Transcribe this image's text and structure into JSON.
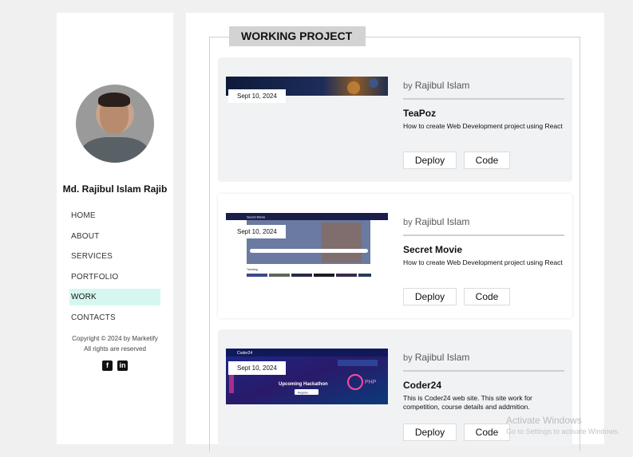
{
  "sidebar": {
    "name": "Md. Rajibul Islam Rajib",
    "nav": [
      {
        "label": "HOME"
      },
      {
        "label": "ABOUT"
      },
      {
        "label": "SERVICES"
      },
      {
        "label": "PORTFOLIO"
      },
      {
        "label": "WORK"
      },
      {
        "label": "CONTACTS"
      }
    ],
    "active_item": "WORK",
    "copyright_line1": "Copyright © 2024 by Marketify",
    "copyright_line2": "All rights are reserved",
    "social_icons": [
      "facebook-icon",
      "linkedin-icon"
    ]
  },
  "main": {
    "heading": "WORKING PROJECT",
    "projects": [
      {
        "date": "Sept 10, 2024",
        "by_prefix": "by",
        "author": "Rajibul Islam",
        "title": "TeaPoz",
        "description": "How to create Web Development project using React",
        "deploy_label": "Deploy",
        "code_label": "Code"
      },
      {
        "date": "Sept 10, 2024",
        "by_prefix": "by",
        "author": "Rajibul Islam",
        "title": "Secret Movie",
        "description": "How to create Web Development project using React",
        "deploy_label": "Deploy",
        "code_label": "Code",
        "thumb_nav_title": "Secret Movie",
        "thumb_section": "Trending"
      },
      {
        "date": "Sept 10, 2024",
        "by_prefix": "by",
        "author": "Rajibul Islam",
        "title": "Coder24",
        "description": "This is Coder24 web site. This site work for competition, course details and addmition.",
        "deploy_label": "Deploy",
        "code_label": "Code",
        "thumb_brand": "Coder24",
        "thumb_headline": "Upcoming Hackathon",
        "thumb_button": "Register",
        "thumb_badge": "PHP"
      }
    ]
  },
  "watermark": {
    "line1": "Activate Windows",
    "line2": "Go to Settings to activate Windows."
  },
  "colors": {
    "active_nav_bg": "#d6f7ef",
    "card_bg": "#f1f2f4",
    "heading_bg": "#d3d3d3"
  }
}
